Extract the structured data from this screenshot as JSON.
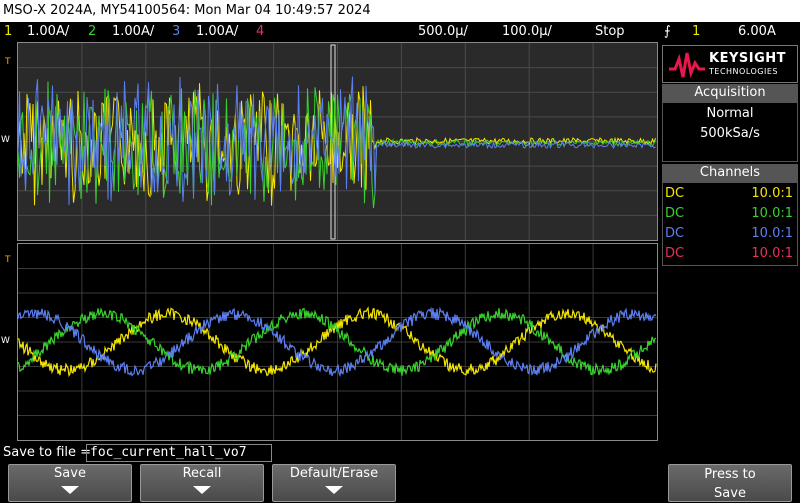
{
  "title_bar": "MSO-X 2024A, MY54100564: Mon Mar 04 10:49:57 2024",
  "status": {
    "channels": [
      {
        "num": "1",
        "scale": "1.00A/",
        "color": "#f5e600"
      },
      {
        "num": "2",
        "scale": "1.00A/",
        "color": "#39d12e"
      },
      {
        "num": "3",
        "scale": "1.00A/",
        "color": "#5b7ff0"
      },
      {
        "num": "4",
        "scale": "",
        "color": "#e8315a"
      }
    ],
    "timebase": "500.0µ/",
    "zoom_timebase": "100.0µ/",
    "run_state": "Stop",
    "trigger_icon": "trigger-edge-icon",
    "trigger_source": "1",
    "trigger_level": "6.00A"
  },
  "brand": {
    "name": "KEYSIGHT",
    "sub": "TECHNOLOGIES",
    "accent": "#e8194a"
  },
  "acquisition": {
    "title": "Acquisition",
    "mode": "Normal",
    "rate": "500kSa/s"
  },
  "channels_panel": {
    "title": "Channels",
    "rows": [
      {
        "coupling": "DC",
        "probe": "10.0:1",
        "color": "#f5e600"
      },
      {
        "coupling": "DC",
        "probe": "10.0:1",
        "color": "#39d12e"
      },
      {
        "coupling": "DC",
        "probe": "10.0:1",
        "color": "#5b7ff0"
      },
      {
        "coupling": "DC",
        "probe": "10.0:1",
        "color": "#e8315a"
      }
    ]
  },
  "markers": {
    "trigger": "T",
    "ground": "W"
  },
  "save": {
    "label": "Save to file =",
    "filename": "foc_current_hall_vo7"
  },
  "softkeys": [
    {
      "label": "Save"
    },
    {
      "label": "Recall"
    },
    {
      "label": "Default/Erase"
    },
    {
      "label": "Press to Save",
      "line1": "Press to",
      "line2": "Save"
    }
  ]
}
